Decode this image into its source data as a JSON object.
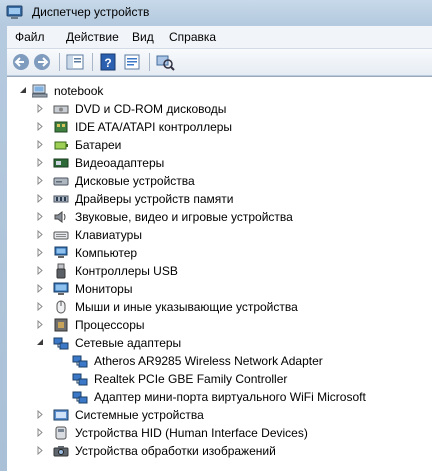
{
  "window": {
    "title": "Диспетчер устройств"
  },
  "menu": [
    "Файл",
    "Действие",
    "Вид",
    "Справка"
  ],
  "tree": {
    "root": "notebook",
    "categories": [
      {
        "label": "DVD и CD-ROM дисководы",
        "icon": "dvd-drive-icon"
      },
      {
        "label": "IDE ATA/ATAPI контроллеры",
        "icon": "ide-controller-icon"
      },
      {
        "label": "Батареи",
        "icon": "battery-icon"
      },
      {
        "label": "Видеоадаптеры",
        "icon": "display-adapter-icon"
      },
      {
        "label": "Дисковые устройства",
        "icon": "disk-drive-icon"
      },
      {
        "label": "Драйверы устройств памяти",
        "icon": "memory-driver-icon"
      },
      {
        "label": "Звуковые, видео и игровые устройства",
        "icon": "speaker-icon"
      },
      {
        "label": "Клавиатуры",
        "icon": "keyboard-icon"
      },
      {
        "label": "Компьютер",
        "icon": "computer-icon"
      },
      {
        "label": "Контроллеры USB",
        "icon": "usb-icon"
      },
      {
        "label": "Мониторы",
        "icon": "monitor-icon"
      },
      {
        "label": "Мыши и иные указывающие устройства",
        "icon": "mouse-icon"
      },
      {
        "label": "Процессоры",
        "icon": "processor-icon"
      },
      {
        "label": "Сетевые адаптеры",
        "icon": "network-adapter-icon",
        "expanded": true,
        "children": [
          "Atheros AR9285 Wireless Network Adapter",
          "Realtek PCIe GBE Family Controller",
          "Адаптер мини-порта виртуального WiFi Microsoft"
        ]
      },
      {
        "label": "Системные устройства",
        "icon": "system-devices-icon"
      },
      {
        "label": "Устройства HID (Human Interface Devices)",
        "icon": "hid-icon"
      },
      {
        "label": "Устройства обработки изображений",
        "icon": "imaging-device-icon"
      }
    ]
  },
  "colors": {
    "accent": "#3c78c8",
    "menubar": "#f1f4f8",
    "frame": "#b5cadf"
  }
}
